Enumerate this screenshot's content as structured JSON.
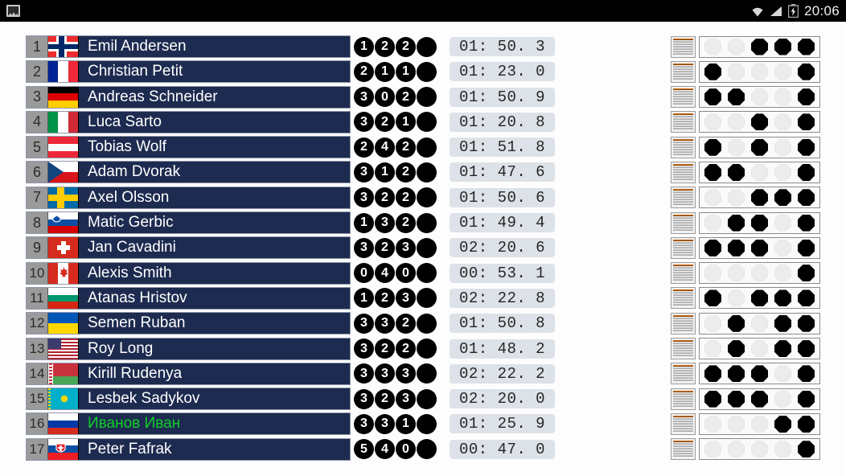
{
  "statusbar": {
    "time": "20:06",
    "icons": [
      "screenshot-icon",
      "wifi-icon",
      "signal-icon",
      "battery-charging-icon"
    ]
  },
  "colors": {
    "row_bg": "#1d2b50",
    "rank_bg": "#9a9a9a",
    "highlight_name": "#12cc2b",
    "time_bg": "#dde2e8",
    "penalty_circle": "#000000",
    "page_bg": "#fdfdfd"
  },
  "athletes": [
    {
      "rank": "1",
      "country": "Norway",
      "flag": "no",
      "name": "Emil Andersen",
      "highlighted": false,
      "penalties": [
        "1",
        "2",
        "2",
        ""
      ],
      "time": "01: 50. 3",
      "targets": [
        0,
        0,
        1,
        1,
        1
      ]
    },
    {
      "rank": "2",
      "country": "France",
      "flag": "fr",
      "name": "Christian Petit",
      "highlighted": false,
      "penalties": [
        "2",
        "1",
        "1",
        ""
      ],
      "time": "01: 23. 0",
      "targets": [
        1,
        0,
        0,
        0,
        1
      ]
    },
    {
      "rank": "3",
      "country": "Germany",
      "flag": "de",
      "name": "Andreas Schneider",
      "highlighted": false,
      "penalties": [
        "3",
        "0",
        "2",
        ""
      ],
      "time": "01: 50. 9",
      "targets": [
        1,
        1,
        0,
        0,
        1
      ]
    },
    {
      "rank": "4",
      "country": "Italy",
      "flag": "it",
      "name": "Luca Sarto",
      "highlighted": false,
      "penalties": [
        "3",
        "2",
        "1",
        ""
      ],
      "time": "01: 20. 8",
      "targets": [
        0,
        0,
        1,
        0,
        1
      ]
    },
    {
      "rank": "5",
      "country": "Austria",
      "flag": "at",
      "name": "Tobias Wolf",
      "highlighted": false,
      "penalties": [
        "2",
        "4",
        "2",
        ""
      ],
      "time": "01: 51. 8",
      "targets": [
        1,
        0,
        1,
        0,
        1
      ]
    },
    {
      "rank": "6",
      "country": "Czechia",
      "flag": "cz",
      "name": "Adam Dvorak",
      "highlighted": false,
      "penalties": [
        "3",
        "1",
        "2",
        ""
      ],
      "time": "01: 47. 6",
      "targets": [
        1,
        1,
        0,
        0,
        1
      ]
    },
    {
      "rank": "7",
      "country": "Sweden",
      "flag": "se",
      "name": "Axel Olsson",
      "highlighted": false,
      "penalties": [
        "3",
        "2",
        "2",
        ""
      ],
      "time": "01: 50. 6",
      "targets": [
        0,
        0,
        1,
        1,
        1
      ]
    },
    {
      "rank": "8",
      "country": "Slovenia",
      "flag": "si",
      "name": "Matic Gerbic",
      "highlighted": false,
      "penalties": [
        "1",
        "3",
        "2",
        ""
      ],
      "time": "01: 49. 4",
      "targets": [
        0,
        1,
        1,
        0,
        1
      ]
    },
    {
      "rank": "9",
      "country": "Switzerland",
      "flag": "ch",
      "name": "Jan  Cavadini",
      "highlighted": false,
      "penalties": [
        "3",
        "2",
        "3",
        ""
      ],
      "time": "02: 20. 6",
      "targets": [
        1,
        1,
        1,
        0,
        1
      ]
    },
    {
      "rank": "10",
      "country": "Canada",
      "flag": "ca",
      "name": "Alexis Smith",
      "highlighted": false,
      "penalties": [
        "0",
        "4",
        "0",
        ""
      ],
      "time": "00: 53. 1",
      "targets": [
        0,
        0,
        0,
        0,
        1
      ]
    },
    {
      "rank": "11",
      "country": "Bulgaria",
      "flag": "bg",
      "name": "Atanas Hristov",
      "highlighted": false,
      "penalties": [
        "1",
        "2",
        "3",
        ""
      ],
      "time": "02: 22. 8",
      "targets": [
        1,
        0,
        1,
        1,
        1
      ]
    },
    {
      "rank": "12",
      "country": "Ukraine",
      "flag": "ua",
      "name": "Semen Ruban",
      "highlighted": false,
      "penalties": [
        "3",
        "3",
        "2",
        ""
      ],
      "time": "01: 50. 8",
      "targets": [
        0,
        1,
        0,
        1,
        1
      ]
    },
    {
      "rank": "13",
      "country": "United States",
      "flag": "us",
      "name": "Roy Long",
      "highlighted": false,
      "penalties": [
        "3",
        "2",
        "2",
        ""
      ],
      "time": "01: 48. 2",
      "targets": [
        0,
        1,
        0,
        1,
        1
      ]
    },
    {
      "rank": "14",
      "country": "Belarus",
      "flag": "by",
      "name": "Kirill Rudenya",
      "highlighted": false,
      "penalties": [
        "3",
        "3",
        "3",
        ""
      ],
      "time": "02: 22. 2",
      "targets": [
        1,
        1,
        1,
        0,
        1
      ]
    },
    {
      "rank": "15",
      "country": "Kazakhstan",
      "flag": "kz",
      "name": "Lesbek Sadykov",
      "highlighted": false,
      "penalties": [
        "3",
        "2",
        "3",
        ""
      ],
      "time": "02: 20. 0",
      "targets": [
        1,
        1,
        1,
        0,
        1
      ]
    },
    {
      "rank": "16",
      "country": "Russia",
      "flag": "ru",
      "name": "Иванов Иван",
      "highlighted": true,
      "penalties": [
        "3",
        "3",
        "1",
        ""
      ],
      "time": "01: 25. 9",
      "targets": [
        0,
        0,
        0,
        1,
        1
      ]
    },
    {
      "rank": "17",
      "country": "Slovakia",
      "flag": "sk",
      "name": "Peter Fafrak",
      "highlighted": false,
      "penalties": [
        "5",
        "4",
        "0",
        ""
      ],
      "time": "00: 47. 0",
      "targets": [
        0,
        0,
        0,
        0,
        1
      ]
    }
  ]
}
